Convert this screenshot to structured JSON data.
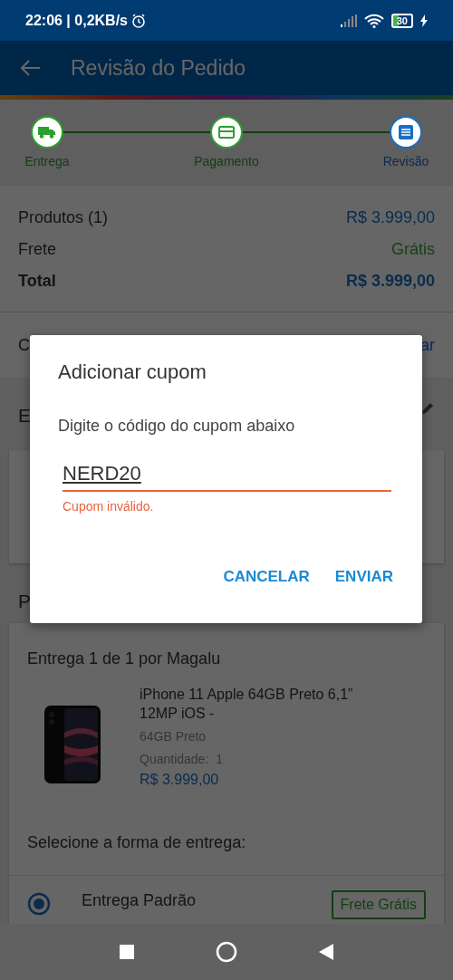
{
  "status_bar": {
    "time": "22:06 | 0,2KB/s",
    "battery": "30"
  },
  "app_bar": {
    "title": "Revisão do Pedido"
  },
  "steps": [
    {
      "label": "Entrega",
      "kind": "truck",
      "selected": false
    },
    {
      "label": "Pagamento",
      "kind": "card",
      "selected": false
    },
    {
      "label": "Revisão",
      "kind": "list",
      "selected": true
    }
  ],
  "summary": [
    {
      "label": "Produtos (1)",
      "value": "R$ 3.999,00",
      "kind": "price"
    },
    {
      "label": "Frete",
      "value": "Grátis",
      "kind": "free"
    },
    {
      "label": "Total",
      "value": "R$ 3.999,00",
      "kind": "total"
    }
  ],
  "coupon_row": {
    "left": "C",
    "right": "ar"
  },
  "address_section": {
    "heading": "E"
  },
  "products_section": {
    "heading": "P",
    "delivery_title": "Entrega 1 de 1 por Magalu",
    "product": {
      "name": "iPhone 11 Apple 64GB Preto 6,1” 12MP iOS -",
      "variant": "64GB Preto",
      "quantity_label": "Quantidade:",
      "quantity": "1",
      "price": "R$ 3.999,00"
    },
    "shipping_prompt": "Selecione a forma de entrega:",
    "shipping_options": [
      {
        "label": "Entrega Padrão",
        "badge": "Frete Grátis",
        "selected": true
      }
    ]
  },
  "dialog": {
    "title": "Adicionar cupom",
    "message": "Digite o código do cupom abaixo",
    "value": "NERD20",
    "error": "Cupom inválido.",
    "buttons": [
      "CANCELAR",
      "ENVIAR"
    ]
  }
}
